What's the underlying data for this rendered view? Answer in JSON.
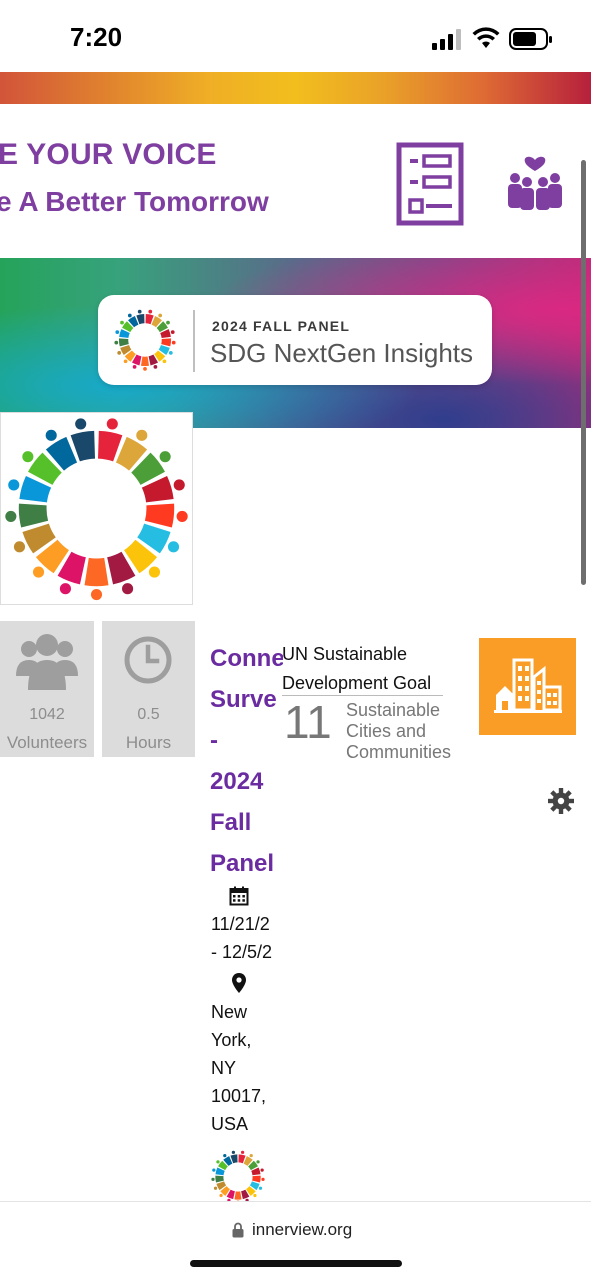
{
  "status_bar": {
    "time": "7:20",
    "icons": [
      "signal-icon",
      "wifi-icon",
      "battery-icon"
    ]
  },
  "banner": {
    "line1": "E YOUR VOICE",
    "line2": "e A Better Tomorrow",
    "icons": [
      "survey-form-icon",
      "community-icon"
    ],
    "accent_color": "#7f3fa0"
  },
  "hero": {
    "kicker": "2024 FALL PANEL",
    "name": "SDG NextGen Insights"
  },
  "stats": {
    "volunteers": {
      "count": "1042",
      "label": "Volunteers"
    },
    "hours": {
      "count": "0.5",
      "label": "Hours"
    }
  },
  "event": {
    "title_lines": [
      "Conne",
      "Surve",
      "-",
      "2024",
      "Fall",
      "Panel"
    ],
    "date_lines": [
      "11/21/2",
      "- 12/5/2"
    ],
    "address_lines": [
      "New",
      "York,",
      "NY",
      "10017,",
      "USA"
    ],
    "title_color": "#6a2ca0"
  },
  "sdg_goal": {
    "header": "UN Sustainable Development Goal",
    "number": "11",
    "name": "Sustainable Cities and Communities",
    "tile_color": "#f99d26"
  },
  "browser": {
    "url": "innerview.org"
  }
}
